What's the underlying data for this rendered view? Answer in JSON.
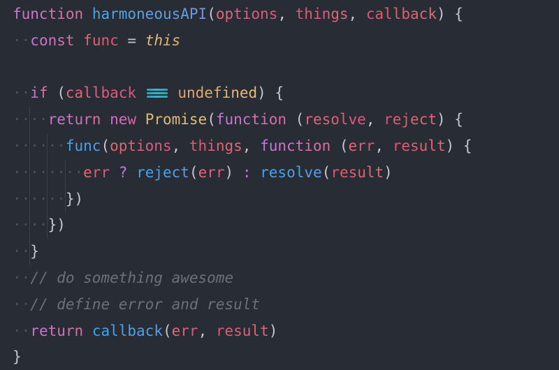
{
  "editor": {
    "title": "code-snippet",
    "language": "javascript",
    "background_color": "#282c34",
    "indent_guide_color": "#3a404c",
    "whitespace_dot_color": "#4b5160",
    "font_size_px": 21,
    "line_height_px": 37.8,
    "line_count": 14,
    "palette": {
      "keyword": "#c678dd",
      "keyword_end": "#e06c9f",
      "function_name": "#4aa8e8",
      "function_name_end": "#6f9ae0",
      "parameter": "#e06c75",
      "parameter_end": "#e0537e",
      "class_builtin": "#e5c07b",
      "punctuation": "#c3c8d1",
      "comment": "#6b717d",
      "ligature_equality": "#35b6c9"
    },
    "code_text": "function harmoneousAPI(options, things, callback) {\n  const func = this\n\n  if (callback === undefined) {\n    return new Promise(function (resolve, reject) {\n      func(options, things, function (err, result) {\n        err ? reject(err) : resolve(result)\n      })\n    })\n  }\n  // do something awesome\n  // define error and result\n  return callback(err, result)\n}",
    "lines": [
      {
        "n": 1,
        "indent": 0,
        "guides": 0,
        "tokens": [
          {
            "t": "function",
            "c": "kw"
          },
          {
            "t": " ",
            "c": "punc"
          },
          {
            "t": "harmoneousAPI",
            "c": "fn"
          },
          {
            "t": "(",
            "c": "punc"
          },
          {
            "t": "options",
            "c": "param"
          },
          {
            "t": ", ",
            "c": "punc"
          },
          {
            "t": "things",
            "c": "param2"
          },
          {
            "t": ", ",
            "c": "punc"
          },
          {
            "t": "callback",
            "c": "param2"
          },
          {
            "t": ") {",
            "c": "punc"
          }
        ]
      },
      {
        "n": 2,
        "indent": 1,
        "guides": 0,
        "tokens": [
          {
            "t": "const",
            "c": "kw"
          },
          {
            "t": " ",
            "c": "punc"
          },
          {
            "t": "func",
            "c": "param"
          },
          {
            "t": " ",
            "c": "punc"
          },
          {
            "t": "=",
            "c": "punc"
          },
          {
            "t": " ",
            "c": "punc"
          },
          {
            "t": "this",
            "c": "this"
          }
        ]
      },
      {
        "n": 3,
        "indent": 0,
        "guides": 0,
        "tokens": []
      },
      {
        "n": 4,
        "indent": 1,
        "guides": 0,
        "tokens": [
          {
            "t": "if",
            "c": "kw"
          },
          {
            "t": " (",
            "c": "punc"
          },
          {
            "t": "callback",
            "c": "param"
          },
          {
            "t": " ",
            "c": "punc"
          },
          {
            "t": "===",
            "c": "lig"
          },
          {
            "t": " ",
            "c": "punc"
          },
          {
            "t": "undefined",
            "c": "cls2"
          },
          {
            "t": ") {",
            "c": "punc"
          }
        ]
      },
      {
        "n": 5,
        "indent": 2,
        "guides": 1,
        "tokens": [
          {
            "t": "return",
            "c": "kw"
          },
          {
            "t": " ",
            "c": "punc"
          },
          {
            "t": "new",
            "c": "kw2"
          },
          {
            "t": " ",
            "c": "punc"
          },
          {
            "t": "Promise",
            "c": "cls"
          },
          {
            "t": "(",
            "c": "punc"
          },
          {
            "t": "function",
            "c": "kw"
          },
          {
            "t": " (",
            "c": "punc"
          },
          {
            "t": "resolve",
            "c": "param"
          },
          {
            "t": ", ",
            "c": "punc"
          },
          {
            "t": "reject",
            "c": "param2"
          },
          {
            "t": ") {",
            "c": "punc"
          }
        ]
      },
      {
        "n": 6,
        "indent": 3,
        "guides": 2,
        "tokens": [
          {
            "t": "func",
            "c": "fn2"
          },
          {
            "t": "(",
            "c": "punc"
          },
          {
            "t": "options",
            "c": "param"
          },
          {
            "t": ", ",
            "c": "punc"
          },
          {
            "t": "things",
            "c": "param2"
          },
          {
            "t": ", ",
            "c": "punc"
          },
          {
            "t": "function",
            "c": "kw"
          },
          {
            "t": " (",
            "c": "punc"
          },
          {
            "t": "err",
            "c": "param"
          },
          {
            "t": ", ",
            "c": "punc"
          },
          {
            "t": "result",
            "c": "param2"
          },
          {
            "t": ") {",
            "c": "punc"
          }
        ]
      },
      {
        "n": 7,
        "indent": 4,
        "guides": 3,
        "tokens": [
          {
            "t": "err",
            "c": "param"
          },
          {
            "t": " ",
            "c": "punc"
          },
          {
            "t": "?",
            "c": "op"
          },
          {
            "t": " ",
            "c": "punc"
          },
          {
            "t": "reject",
            "c": "fn2"
          },
          {
            "t": "(",
            "c": "punc"
          },
          {
            "t": "err",
            "c": "param"
          },
          {
            "t": ")",
            "c": "punc"
          },
          {
            "t": " ",
            "c": "punc"
          },
          {
            "t": ":",
            "c": "op"
          },
          {
            "t": " ",
            "c": "punc"
          },
          {
            "t": "resolve",
            "c": "fn2"
          },
          {
            "t": "(",
            "c": "punc"
          },
          {
            "t": "result",
            "c": "param2"
          },
          {
            "t": ")",
            "c": "punc"
          }
        ]
      },
      {
        "n": 8,
        "indent": 3,
        "guides": 3,
        "tokens": [
          {
            "t": "})",
            "c": "punc"
          }
        ]
      },
      {
        "n": 9,
        "indent": 2,
        "guides": 2,
        "tokens": [
          {
            "t": "})",
            "c": "punc"
          }
        ]
      },
      {
        "n": 10,
        "indent": 1,
        "guides": 1,
        "tokens": [
          {
            "t": "}",
            "c": "punc"
          }
        ]
      },
      {
        "n": 11,
        "indent": 1,
        "guides": 0,
        "tokens": [
          {
            "t": "// do something awesome",
            "c": "comment"
          }
        ]
      },
      {
        "n": 12,
        "indent": 1,
        "guides": 0,
        "tokens": [
          {
            "t": "// define error and result",
            "c": "comment"
          }
        ]
      },
      {
        "n": 13,
        "indent": 1,
        "guides": 0,
        "tokens": [
          {
            "t": "return",
            "c": "kw"
          },
          {
            "t": " ",
            "c": "punc"
          },
          {
            "t": "callback",
            "c": "fn2"
          },
          {
            "t": "(",
            "c": "punc"
          },
          {
            "t": "err",
            "c": "param"
          },
          {
            "t": ", ",
            "c": "punc"
          },
          {
            "t": "result",
            "c": "param2"
          },
          {
            "t": ")",
            "c": "punc"
          }
        ]
      },
      {
        "n": 14,
        "indent": 0,
        "guides": 0,
        "tokens": [
          {
            "t": "}",
            "c": "punc"
          }
        ]
      }
    ]
  }
}
